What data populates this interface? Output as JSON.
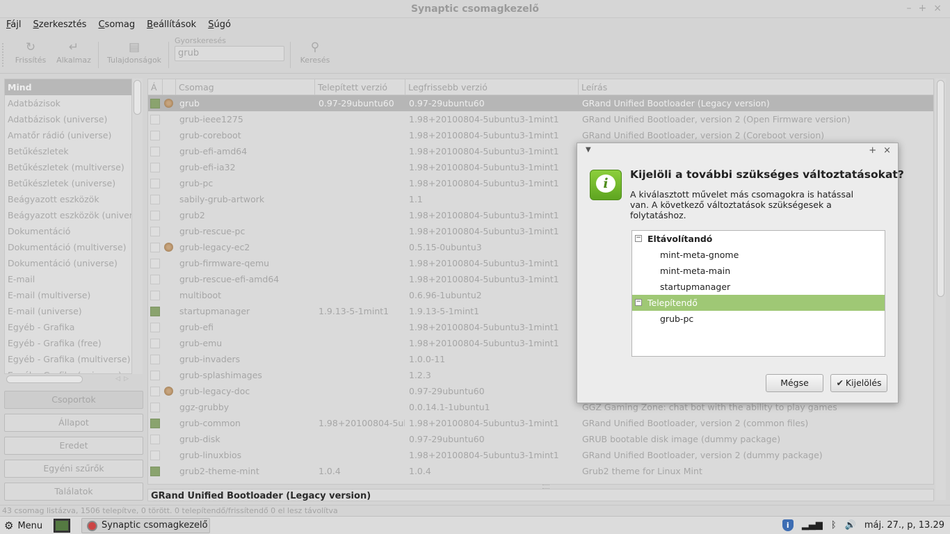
{
  "window": {
    "title": "Synaptic csomagkezelő",
    "controls": [
      "–",
      "+",
      "×"
    ]
  },
  "menubar": [
    {
      "u": "F",
      "rest": "ájl"
    },
    {
      "u": "S",
      "rest": "zerkesztés"
    },
    {
      "u": "C",
      "rest": "somag"
    },
    {
      "u": "B",
      "rest": "eállítások"
    },
    {
      "u": "S",
      "rest": "úgó"
    }
  ],
  "toolbar": {
    "reload_label": "Frissítés",
    "apply_label": "Alkalmaz",
    "properties_label": "Tulajdonságok",
    "quicksearch_label": "Gyorskeresés",
    "quicksearch_value": "grub",
    "search_label": "Keresés"
  },
  "sections": [
    "Mind",
    "Adatbázisok",
    "Adatbázisok (universe)",
    "Amatőr rádió (universe)",
    "Betűkészletek",
    "Betűkészletek (multiverse)",
    "Betűkészletek (universe)",
    "Beágyazott eszközök",
    "Beágyazott eszközök (univers",
    "Dokumentáció",
    "Dokumentáció (multiverse)",
    "Dokumentáció (universe)",
    "E-mail",
    "E-mail (multiverse)",
    "E-mail (universe)",
    "Egyéb - Grafika",
    "Egyéb - Grafika (free)",
    "Egyéb - Grafika (multiverse)",
    "Egyéb - Grafika (universe)"
  ],
  "filter_buttons": [
    "Csoportok",
    "Állapot",
    "Eredet",
    "Egyéni szűrők",
    "Találatok"
  ],
  "table": {
    "headers": [
      "Á",
      "",
      "Csomag",
      "Telepített verzió",
      "Legfrissebb verzió",
      "Leírás"
    ],
    "rows": [
      {
        "state": "inst",
        "sup": true,
        "name": "grub",
        "installed": "0.97-29ubuntu60",
        "latest": "0.97-29ubuntu60",
        "desc": "GRand Unified Bootloader (Legacy version)",
        "selected": true
      },
      {
        "state": "",
        "sup": false,
        "name": "grub-ieee1275",
        "installed": "",
        "latest": "1.98+20100804-5ubuntu3-1mint1",
        "desc": "GRand Unified Bootloader, version 2 (Open Firmware version)"
      },
      {
        "state": "",
        "sup": false,
        "name": "grub-coreboot",
        "installed": "",
        "latest": "1.98+20100804-5ubuntu3-1mint1",
        "desc": "GRand Unified Bootloader, version 2 (Coreboot version)"
      },
      {
        "state": "",
        "sup": false,
        "name": "grub-efi-amd64",
        "installed": "",
        "latest": "1.98+20100804-5ubuntu3-1mint1",
        "desc": ""
      },
      {
        "state": "",
        "sup": false,
        "name": "grub-efi-ia32",
        "installed": "",
        "latest": "1.98+20100804-5ubuntu3-1mint1",
        "desc": ""
      },
      {
        "state": "",
        "sup": false,
        "name": "grub-pc",
        "installed": "",
        "latest": "1.98+20100804-5ubuntu3-1mint1",
        "desc": ""
      },
      {
        "state": "",
        "sup": false,
        "name": "sabily-grub-artwork",
        "installed": "",
        "latest": "1.1",
        "desc": ""
      },
      {
        "state": "",
        "sup": false,
        "name": "grub2",
        "installed": "",
        "latest": "1.98+20100804-5ubuntu3-1mint1",
        "desc": ""
      },
      {
        "state": "",
        "sup": false,
        "name": "grub-rescue-pc",
        "installed": "",
        "latest": "1.98+20100804-5ubuntu3-1mint1",
        "desc": ""
      },
      {
        "state": "",
        "sup": true,
        "name": "grub-legacy-ec2",
        "installed": "",
        "latest": "0.5.15-0ubuntu3",
        "desc": ""
      },
      {
        "state": "",
        "sup": false,
        "name": "grub-firmware-qemu",
        "installed": "",
        "latest": "1.98+20100804-5ubuntu3-1mint1",
        "desc": ""
      },
      {
        "state": "",
        "sup": false,
        "name": "grub-rescue-efi-amd64",
        "installed": "",
        "latest": "1.98+20100804-5ubuntu3-1mint1",
        "desc": ""
      },
      {
        "state": "",
        "sup": false,
        "name": "multiboot",
        "installed": "",
        "latest": "0.6.96-1ubuntu2",
        "desc": ""
      },
      {
        "state": "inst",
        "sup": false,
        "name": "startupmanager",
        "installed": "1.9.13-5-1mint1",
        "latest": "1.9.13-5-1mint1",
        "desc": ""
      },
      {
        "state": "",
        "sup": false,
        "name": "grub-efi",
        "installed": "",
        "latest": "1.98+20100804-5ubuntu3-1mint1",
        "desc": ""
      },
      {
        "state": "",
        "sup": false,
        "name": "grub-emu",
        "installed": "",
        "latest": "1.98+20100804-5ubuntu3-1mint1",
        "desc": ""
      },
      {
        "state": "",
        "sup": false,
        "name": "grub-invaders",
        "installed": "",
        "latest": "1.0.0-11",
        "desc": ""
      },
      {
        "state": "",
        "sup": false,
        "name": "grub-splashimages",
        "installed": "",
        "latest": "1.2.3",
        "desc": ""
      },
      {
        "state": "",
        "sup": true,
        "name": "grub-legacy-doc",
        "installed": "",
        "latest": "0.97-29ubuntu60",
        "desc": ""
      },
      {
        "state": "",
        "sup": false,
        "name": "ggz-grubby",
        "installed": "",
        "latest": "0.0.14.1-1ubuntu1",
        "desc": "GGZ Gaming Zone: chat bot with the ability to play games"
      },
      {
        "state": "inst",
        "sup": false,
        "name": "grub-common",
        "installed": "1.98+20100804-5ub",
        "latest": "1.98+20100804-5ubuntu3-1mint1",
        "desc": "GRand Unified Bootloader, version 2 (common files)"
      },
      {
        "state": "",
        "sup": false,
        "name": "grub-disk",
        "installed": "",
        "latest": "0.97-29ubuntu60",
        "desc": "GRUB bootable disk image (dummy package)"
      },
      {
        "state": "",
        "sup": false,
        "name": "grub-linuxbios",
        "installed": "",
        "latest": "1.98+20100804-5ubuntu3-1mint1",
        "desc": "GRand Unified Bootloader, version 2 (dummy package)"
      },
      {
        "state": "inst",
        "sup": false,
        "name": "grub2-theme-mint",
        "installed": "1.0.4",
        "latest": "1.0.4",
        "desc": "Grub2 theme for Linux Mint"
      }
    ]
  },
  "details_title": "GRand Unified Bootloader (Legacy version)",
  "statusbar": "43 csomag listázva, 1506 telepítve, 0 törött. 0 telepítendő/frissítendő 0 el lesz távolítva",
  "taskbar": {
    "menu_label": "Menu",
    "task_label": "Synaptic csomagkezelő",
    "clock": "máj. 27., p, 13.29"
  },
  "dialog": {
    "controls": [
      "+",
      "×"
    ],
    "heading": "Kijelöli a további szükséges változtatásokat?",
    "text": "A kiválasztott művelet más csomagokra is hatással van. A következő változtatások szükségesek a folytatáshoz.",
    "groups": [
      {
        "label": "Eltávolítandó",
        "items": [
          "mint-meta-gnome",
          "mint-meta-main",
          "startupmanager"
        ]
      },
      {
        "label": "Telepítendő",
        "items": [
          "grub-pc"
        ]
      }
    ],
    "cancel_label": "Mégse",
    "ok_label": "Kijelölés"
  }
}
